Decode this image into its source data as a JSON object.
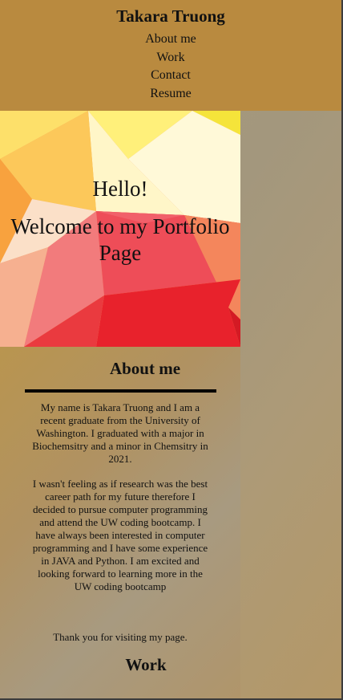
{
  "header": {
    "title": "Takara Truong",
    "nav": [
      "About me",
      "Work",
      "Contact",
      "Resume"
    ]
  },
  "hero": {
    "greeting": "Hello!",
    "welcome": "Welcome to my Portfolio Page"
  },
  "about": {
    "heading": "About me",
    "paragraphs": [
      "My name is Takara Truong and I am a recent graduate from the University of Washington. I graduated with a major in Biochemsitry and a minor in Chemsitry in 2021.",
      "I wasn't feeling as if research was the best career path for my future therefore I decided to pursue computer programming and attend the UW coding bootcamp. I have always been interested in computer programming and I have some experience in JAVA and Python. I am excited and looking forward to learning more in the UW coding bootcamp",
      "Thank you for visiting my page."
    ]
  },
  "work": {
    "heading": "Work"
  },
  "colors": {
    "header_bg": "#b98a3f",
    "page_bg": "#a89a80",
    "hero_red": "#e8222c",
    "hero_yellow": "#fde64a"
  }
}
